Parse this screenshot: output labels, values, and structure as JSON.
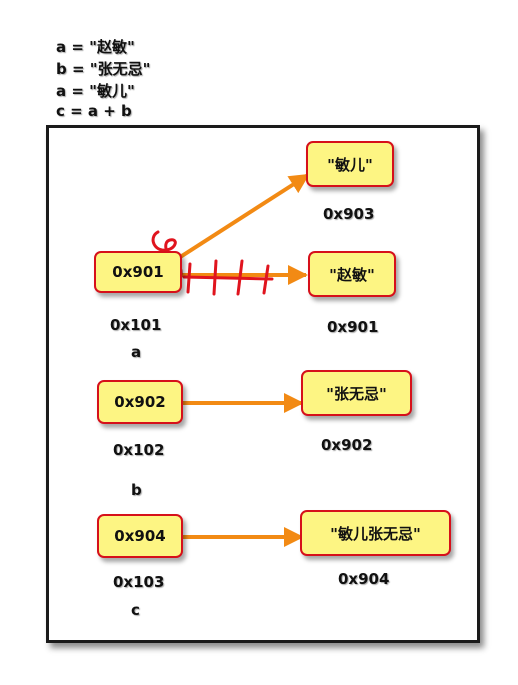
{
  "code": {
    "line1": "a = \"赵敏\"",
    "line2": "b = \"张无忌\"",
    "line3": "a = \"敏儿\"",
    "line4": "c = a + b"
  },
  "variables": [
    {
      "name": "a",
      "stack_addr": "0x101",
      "value": "0x901"
    },
    {
      "name": "b",
      "stack_addr": "0x102",
      "value": "0x902"
    },
    {
      "name": "c",
      "stack_addr": "0x103",
      "value": "0x904"
    }
  ],
  "objects": [
    {
      "value": "\"敏儿\"",
      "addr": "0x903"
    },
    {
      "value": "\"赵敏\"",
      "addr": "0x901"
    },
    {
      "value": "\"张无忌\"",
      "addr": "0x902"
    },
    {
      "value": "\"敏儿张无忌\"",
      "addr": "0x904"
    }
  ],
  "colors": {
    "box_fill": "#fdf583",
    "box_border": "#d6101a",
    "arrow": "#f28a14",
    "annotation": "#e0141e",
    "frame": "#1a1a1a"
  }
}
